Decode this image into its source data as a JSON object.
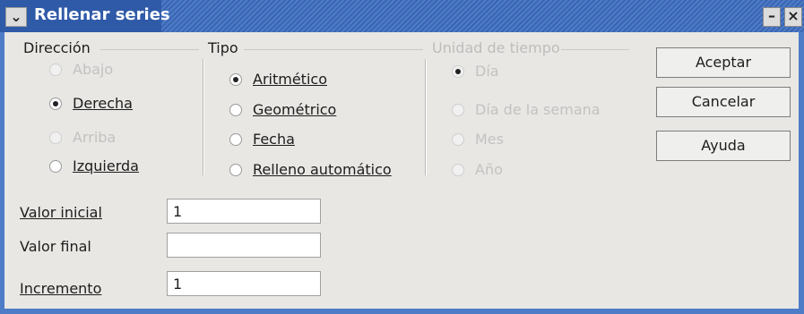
{
  "window": {
    "title": "Rellenar series",
    "sysmenu_glyph": "⌄",
    "min_glyph": "–",
    "close_glyph": "×"
  },
  "groups": {
    "direccion": {
      "label": "Dirección",
      "options": [
        {
          "label": "Abajo",
          "selected": false,
          "disabled": true
        },
        {
          "label": "Derecha",
          "selected": true,
          "disabled": false
        },
        {
          "label": "Arriba",
          "selected": false,
          "disabled": true
        },
        {
          "label": "Izquierda",
          "selected": false,
          "disabled": false
        }
      ]
    },
    "tipo": {
      "label": "Tipo",
      "options": [
        {
          "label": "Aritmético",
          "selected": true,
          "disabled": false
        },
        {
          "label": "Geométrico",
          "selected": false,
          "disabled": false
        },
        {
          "label": "Fecha",
          "selected": false,
          "disabled": false
        },
        {
          "label": "Relleno automático",
          "selected": false,
          "disabled": false
        }
      ]
    },
    "unidad": {
      "label": "Unidad de tiempo",
      "options": [
        {
          "label": "Día",
          "selected": true,
          "disabled": true
        },
        {
          "label": "Día de la semana",
          "selected": false,
          "disabled": true
        },
        {
          "label": "Mes",
          "selected": false,
          "disabled": true
        },
        {
          "label": "Año",
          "selected": false,
          "disabled": true
        }
      ]
    }
  },
  "fields": {
    "start": {
      "label": "Valor inicial",
      "value": "1"
    },
    "end": {
      "label": "Valor final",
      "value": ""
    },
    "increment": {
      "label": "Incremento",
      "value": "1"
    }
  },
  "buttons": {
    "ok": "Aceptar",
    "cancel": "Cancelar",
    "help": "Ayuda"
  }
}
